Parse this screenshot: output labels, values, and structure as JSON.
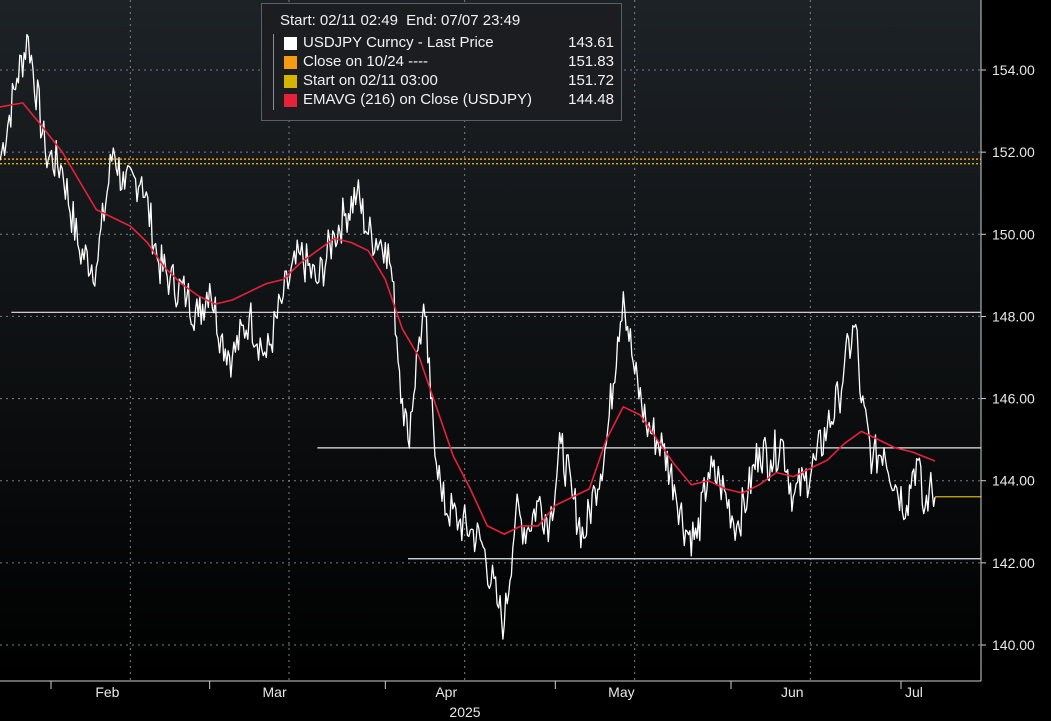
{
  "header": {
    "start_label": "Start:",
    "start_value": "02/11 02:49",
    "end_label": "End:",
    "end_value": "07/07 23:49"
  },
  "legend": [
    {
      "name": "USDJPY Curncy - Last Price",
      "value": "143.61",
      "color": "#ffffff"
    },
    {
      "name": "Close on 10/24 ----",
      "value": "151.83",
      "color": "#f39c12"
    },
    {
      "name": "Start on 02/11 03:00",
      "value": "151.72",
      "color": "#d4b400"
    },
    {
      "name": "EMAVG (216)  on Close (USDJPY)",
      "value": "144.48",
      "color": "#e8213b"
    }
  ],
  "chart_data": {
    "type": "line",
    "x_start": "2025-01-23",
    "x_end": "2025-07-07",
    "ylim": [
      139,
      155.5
    ],
    "y_ticks": [
      "140.00",
      "142.00",
      "144.00",
      "146.00",
      "148.00",
      "150.00",
      "152.00",
      "154.00"
    ],
    "x_ticks": [
      {
        "label": "Feb",
        "date": "2025-02-01"
      },
      {
        "label": "Mar",
        "date": "2025-03-01"
      },
      {
        "label": "Apr",
        "date": "2025-04-01"
      },
      {
        "label": "May",
        "date": "2025-05-01"
      },
      {
        "label": "Jun",
        "date": "2025-06-01"
      },
      {
        "label": "Jul",
        "date": "2025-07-01"
      }
    ],
    "x_title": "2025",
    "grid": true,
    "series": [
      {
        "name": "USDJPY Curncy - Last Price",
        "color": "#ffffff",
        "points": [
          [
            "2025-01-23",
            151.8
          ],
          [
            "2025-01-26",
            153.8
          ],
          [
            "2025-01-28",
            154.8
          ],
          [
            "2025-01-31",
            152.0
          ],
          [
            "2025-02-03",
            151.6
          ],
          [
            "2025-02-06",
            149.6
          ],
          [
            "2025-02-09",
            149.2
          ],
          [
            "2025-02-12",
            152.1
          ],
          [
            "2025-02-14",
            151.1
          ],
          [
            "2025-02-17",
            151.4
          ],
          [
            "2025-02-20",
            149.3
          ],
          [
            "2025-02-22",
            148.9
          ],
          [
            "2025-02-25",
            148.5
          ],
          [
            "2025-02-27",
            148.0
          ],
          [
            "2025-03-01",
            148.8
          ],
          [
            "2025-03-03",
            147.5
          ],
          [
            "2025-03-05",
            147.0
          ],
          [
            "2025-03-08",
            148.0
          ],
          [
            "2025-03-11",
            147.0
          ],
          [
            "2025-03-14",
            148.5
          ],
          [
            "2025-03-17",
            149.5
          ],
          [
            "2025-03-20",
            148.8
          ],
          [
            "2025-03-23",
            150.0
          ],
          [
            "2025-03-25",
            150.5
          ],
          [
            "2025-03-27",
            151.0
          ],
          [
            "2025-03-29",
            150.0
          ],
          [
            "2025-04-01",
            149.8
          ],
          [
            "2025-04-02",
            149.2
          ],
          [
            "2025-04-04",
            146.0
          ],
          [
            "2025-04-05",
            145.0
          ],
          [
            "2025-04-07",
            147.5
          ],
          [
            "2025-04-08",
            148.0
          ],
          [
            "2025-04-09",
            146.0
          ],
          [
            "2025-04-11",
            143.5
          ],
          [
            "2025-04-14",
            143.0
          ],
          [
            "2025-04-16",
            142.8
          ],
          [
            "2025-04-18",
            142.5
          ],
          [
            "2025-04-21",
            140.9
          ],
          [
            "2025-04-22",
            140.5
          ],
          [
            "2025-04-24",
            143.2
          ],
          [
            "2025-04-26",
            142.8
          ],
          [
            "2025-04-28",
            143.5
          ],
          [
            "2025-04-30",
            143.0
          ],
          [
            "2025-05-02",
            144.9
          ],
          [
            "2025-05-04",
            143.6
          ],
          [
            "2025-05-06",
            142.6
          ],
          [
            "2025-05-08",
            143.8
          ],
          [
            "2025-05-10",
            144.9
          ],
          [
            "2025-05-12",
            147.5
          ],
          [
            "2025-05-13",
            148.6
          ],
          [
            "2025-05-15",
            146.6
          ],
          [
            "2025-05-17",
            145.4
          ],
          [
            "2025-05-20",
            144.8
          ],
          [
            "2025-05-22",
            143.9
          ],
          [
            "2025-05-24",
            142.8
          ],
          [
            "2025-05-26",
            142.6
          ],
          [
            "2025-05-28",
            144.2
          ],
          [
            "2025-05-30",
            144.0
          ],
          [
            "2025-06-02",
            142.9
          ],
          [
            "2025-06-04",
            143.7
          ],
          [
            "2025-06-06",
            144.8
          ],
          [
            "2025-06-08",
            144.5
          ],
          [
            "2025-06-10",
            145.0
          ],
          [
            "2025-06-12",
            143.6
          ],
          [
            "2025-06-14",
            144.0
          ],
          [
            "2025-06-16",
            144.5
          ],
          [
            "2025-06-18",
            145.3
          ],
          [
            "2025-06-20",
            146.0
          ],
          [
            "2025-06-21",
            146.8
          ],
          [
            "2025-06-23",
            147.8
          ],
          [
            "2025-06-24",
            145.9
          ],
          [
            "2025-06-26",
            144.5
          ],
          [
            "2025-06-28",
            144.8
          ],
          [
            "2025-06-30",
            143.9
          ],
          [
            "2025-07-02",
            143.4
          ],
          [
            "2025-07-03",
            144.2
          ],
          [
            "2025-07-04",
            144.5
          ],
          [
            "2025-07-05",
            143.2
          ],
          [
            "2025-07-06",
            143.8
          ],
          [
            "2025-07-07",
            143.6
          ]
        ]
      },
      {
        "name": "EMAVG (216)  on Close (USDJPY)",
        "color": "#e8213b",
        "points": [
          [
            "2025-01-23",
            153.1
          ],
          [
            "2025-01-27",
            153.2
          ],
          [
            "2025-01-30",
            152.7
          ],
          [
            "2025-02-03",
            152.0
          ],
          [
            "2025-02-06",
            151.3
          ],
          [
            "2025-02-09",
            150.6
          ],
          [
            "2025-02-12",
            150.4
          ],
          [
            "2025-02-15",
            150.2
          ],
          [
            "2025-02-18",
            149.8
          ],
          [
            "2025-02-21",
            149.2
          ],
          [
            "2025-02-24",
            148.8
          ],
          [
            "2025-02-27",
            148.5
          ],
          [
            "2025-03-02",
            148.3
          ],
          [
            "2025-03-05",
            148.4
          ],
          [
            "2025-03-08",
            148.6
          ],
          [
            "2025-03-11",
            148.8
          ],
          [
            "2025-03-14",
            148.9
          ],
          [
            "2025-03-17",
            149.3
          ],
          [
            "2025-03-20",
            149.6
          ],
          [
            "2025-03-23",
            149.9
          ],
          [
            "2025-03-26",
            149.8
          ],
          [
            "2025-03-29",
            149.6
          ],
          [
            "2025-04-01",
            148.9
          ],
          [
            "2025-04-04",
            147.7
          ],
          [
            "2025-04-07",
            147.0
          ],
          [
            "2025-04-10",
            145.8
          ],
          [
            "2025-04-13",
            144.6
          ],
          [
            "2025-04-16",
            143.8
          ],
          [
            "2025-04-19",
            142.9
          ],
          [
            "2025-04-22",
            142.7
          ],
          [
            "2025-04-25",
            142.9
          ],
          [
            "2025-04-28",
            142.9
          ],
          [
            "2025-05-01",
            143.4
          ],
          [
            "2025-05-04",
            143.6
          ],
          [
            "2025-05-07",
            143.8
          ],
          [
            "2025-05-10",
            145.0
          ],
          [
            "2025-05-13",
            145.8
          ],
          [
            "2025-05-16",
            145.6
          ],
          [
            "2025-05-19",
            145.0
          ],
          [
            "2025-05-22",
            144.4
          ],
          [
            "2025-05-25",
            143.9
          ],
          [
            "2025-05-28",
            144.0
          ],
          [
            "2025-05-31",
            143.8
          ],
          [
            "2025-06-03",
            143.7
          ],
          [
            "2025-06-06",
            143.9
          ],
          [
            "2025-06-09",
            144.2
          ],
          [
            "2025-06-12",
            144.1
          ],
          [
            "2025-06-15",
            144.3
          ],
          [
            "2025-06-18",
            144.5
          ],
          [
            "2025-06-21",
            144.9
          ],
          [
            "2025-06-24",
            145.2
          ],
          [
            "2025-06-27",
            145.0
          ],
          [
            "2025-06-30",
            144.8
          ],
          [
            "2025-07-03",
            144.7
          ],
          [
            "2025-07-07",
            144.48
          ]
        ]
      }
    ],
    "reference_lines": [
      {
        "name": "Close on 10/24 ----",
        "y": 151.83,
        "color": "#f39c12"
      },
      {
        "name": "Start on 02/11 03:00",
        "y": 151.72,
        "color": "#d4b400"
      }
    ],
    "support_resistance_lines": [
      {
        "y": 148.1,
        "from": "2025-01-25",
        "to": "2025-07-07"
      },
      {
        "y": 144.8,
        "from": "2025-03-20",
        "to": "2025-07-07"
      },
      {
        "y": 142.1,
        "from": "2025-04-05",
        "to": "2025-07-07"
      }
    ],
    "last_price_marker": {
      "y": 143.61,
      "color": "#d4b400"
    }
  }
}
